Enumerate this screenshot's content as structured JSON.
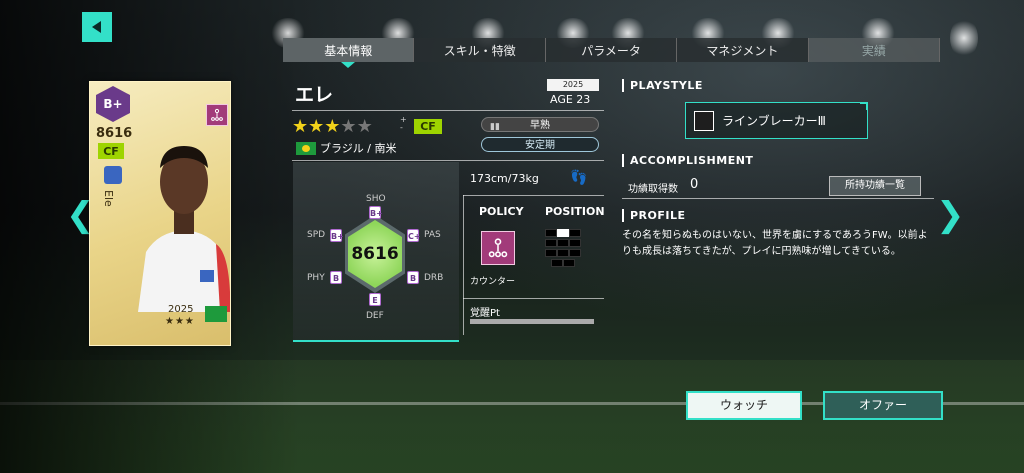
{
  "tabs": [
    {
      "label": "基本情報",
      "active": true
    },
    {
      "label": "スキル・特徴",
      "active": false
    },
    {
      "label": "パラメータ",
      "active": false
    },
    {
      "label": "マネジメント",
      "active": false
    },
    {
      "label": "実績",
      "active": false,
      "disabled": true
    }
  ],
  "card": {
    "rank": "B+",
    "rating": "8616",
    "position": "CF",
    "name_vertical": "Ele",
    "year": "2025",
    "stars": "★★★"
  },
  "player": {
    "name": "エレ",
    "year": "2025",
    "age": "AGE 23",
    "stars_on": 3,
    "stars_total": 5,
    "position": "CF",
    "nation": "ブラジル / 南米",
    "growth_type": "早熟",
    "growth_phase": "安定期",
    "body": "173cm/73kg"
  },
  "stats": {
    "overall": "8616",
    "labels": {
      "sho": "SHO",
      "pas": "PAS",
      "drb": "DRB",
      "def": "DEF",
      "phy": "PHY",
      "spd": "SPD"
    },
    "grades": {
      "sho": "B+",
      "pas": "C+",
      "drb": "B",
      "def": "E",
      "phy": "B",
      "spd": "B+"
    }
  },
  "policy": {
    "header": "POLICY",
    "name": "カウンター"
  },
  "position_section": {
    "header": "POSITION"
  },
  "awakening": {
    "label": "覚醒Pt",
    "progress": 1.0
  },
  "right": {
    "playstyle_header": "PLAYSTYLE",
    "playstyle_name": "ラインブレーカーⅢ",
    "accomplishment_header": "ACCOMPLISHMENT",
    "accomplishment_label": "功績取得数",
    "accomplishment_value": "0",
    "accomplishment_button": "所持功績一覧",
    "profile_header": "PROFILE",
    "profile_text": "その名を知らぬものはいない、世界を虜にするであろうFW。以前よりも成長は落ちてきたが、プレイに円熟味が増してきている。"
  },
  "buttons": {
    "watch": "ウォッチ",
    "offer": "オファー"
  },
  "colors": {
    "accent": "#33e0c8",
    "position_badge": "#9ed400",
    "rank": "#6a3a8a",
    "policy": "#a23b7a"
  },
  "icons": {
    "back": "back-arrow-icon",
    "prev": "chevron-left-icon",
    "next": "chevron-right-icon"
  }
}
